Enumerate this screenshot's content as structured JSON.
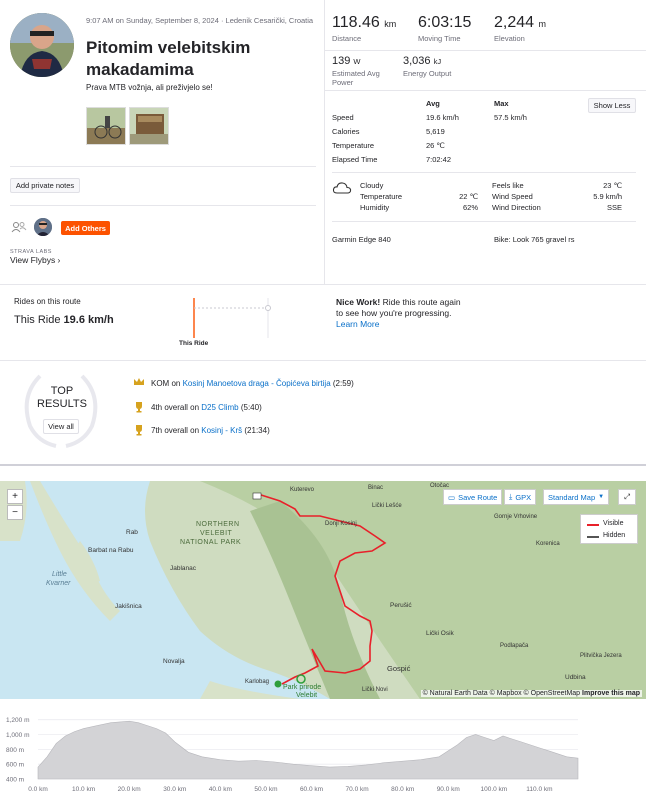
{
  "activity": {
    "datetime": "9:07 AM on Sunday, September 8, 2024",
    "location_sep": " · ",
    "location": "Ledenik Cesarički, Croatia",
    "title_line1": "Pitomim velebitskim",
    "title_line2": "makadamima",
    "description": "Prava MTB vožnja, ali preživjelo se!"
  },
  "buttons": {
    "private_notes": "Add private notes",
    "add_others": "Add Others",
    "show_less": "Show Less",
    "view_all": "View all"
  },
  "labs": {
    "tag": "STRAVA LABS",
    "flybys": "View Flybys ›"
  },
  "stats": {
    "distance": {
      "value": "118.46",
      "unit": "km",
      "label": "Distance"
    },
    "moving_time": {
      "value": "6:03:15",
      "label": "Moving Time"
    },
    "elevation": {
      "value": "2,244",
      "unit": "m",
      "label": "Elevation"
    },
    "power": {
      "value": "139",
      "unit": "W",
      "label1": "Estimated Avg",
      "label2": "Power"
    },
    "energy": {
      "value": "3,036",
      "unit": "kJ",
      "label": "Energy Output"
    }
  },
  "details": {
    "avg_header": "Avg",
    "max_header": "Max",
    "rows": [
      {
        "label": "Speed",
        "avg": "19.6 km/h",
        "max": "57.5 km/h"
      },
      {
        "label": "Calories",
        "avg": "5,619",
        "max": ""
      },
      {
        "label": "Temperature",
        "avg": "26 ℃",
        "max": ""
      },
      {
        "label": "Elapsed Time",
        "avg": "7:02:42",
        "max": ""
      }
    ]
  },
  "weather": {
    "condition": "Cloudy",
    "left": [
      {
        "label": "Temperature",
        "value": "22 ℃"
      },
      {
        "label": "Humidity",
        "value": "62%"
      }
    ],
    "right": [
      {
        "label": "Feels like",
        "value": "23 ℃"
      },
      {
        "label": "Wind Speed",
        "value": "5.9 km/h"
      },
      {
        "label": "Wind Direction",
        "value": "SSE"
      }
    ]
  },
  "device": "Garmin Edge 840",
  "bike": "Bike: Look 765 gravel rs",
  "route": {
    "heading": "Rides on this route",
    "this_ride_prefix": "This Ride",
    "this_ride_speed": "19.6 km/h",
    "chart_label": "This Ride",
    "nice_bold": "Nice Work!",
    "nice_text1": " Ride this route again",
    "nice_text2": "to see how you're progressing.",
    "learn_more": "Learn More"
  },
  "top_results": {
    "line1": "TOP",
    "line2": "RESULTS",
    "items": [
      {
        "rank": "KOM",
        "on": " on ",
        "segment": "Kosinj Manoetova draga - Čopićeva birtija",
        "time": " (2:59)"
      },
      {
        "rank": "4th overall",
        "on": " on ",
        "segment": "D25 Climb",
        "time": " (5:40)"
      },
      {
        "rank": "7th overall",
        "on": " on ",
        "segment": "Kosinj - Krš",
        "time": " (21:34)"
      }
    ]
  },
  "map": {
    "zoom_in": "+",
    "zoom_out": "−",
    "save_route": "Save Route",
    "gpx": "GPX",
    "map_type": "Standard Map",
    "legend_visible": "Visible",
    "legend_hidden": "Hidden",
    "attribution": "© Natural Earth Data © Mapbox © OpenStreetMap",
    "improve": "Improve this map",
    "labels": [
      "NORTHERN",
      "VELEBIT",
      "NATIONAL PARK",
      "Rab",
      "Barbat na Rabu",
      "Little",
      "Kvarner",
      "Jablanac",
      "Jakišnica",
      "Novalja",
      "Karlobag",
      "Park prirode",
      "Velebit",
      "Kuterevo",
      "Donji Kosinj",
      "Perušić",
      "Lički Osik",
      "Gospić",
      "Lički Novi",
      "Otočac",
      "Korenica",
      "Podlapača",
      "Udbina",
      "Lički Lešće",
      "Binac",
      "Gornje Vrhovine",
      "Plitvička Jezera"
    ]
  },
  "elevation_chart": {
    "y_ticks": [
      "1,200 m",
      "1,000 m",
      "800 m",
      "600 m",
      "400 m"
    ],
    "x_ticks": [
      "0.0 km",
      "10.0 km",
      "20.0 km",
      "30.0 km",
      "40.0 km",
      "50.0 km",
      "60.0 km",
      "70.0 km",
      "80.0 km",
      "90.0 km",
      "100.0 km",
      "110.0 km"
    ]
  },
  "chart_data": {
    "type": "area",
    "x_unit": "km",
    "y_unit": "m",
    "ylim": [
      400,
      1250
    ],
    "xlim": [
      0,
      118.46
    ],
    "x": [
      0,
      2,
      4,
      6,
      8,
      10,
      13,
      16,
      18,
      20,
      22,
      24,
      26,
      28,
      30,
      33,
      36,
      40,
      44,
      48,
      52,
      56,
      60,
      64,
      68,
      72,
      76,
      80,
      84,
      88,
      90,
      92,
      94,
      96,
      98,
      100,
      102,
      104,
      106,
      108,
      110,
      112,
      114,
      116,
      118.46
    ],
    "y": [
      560,
      700,
      880,
      980,
      1040,
      1080,
      1120,
      1160,
      1170,
      1180,
      1160,
      1120,
      1080,
      1020,
      900,
      760,
      700,
      660,
      640,
      650,
      630,
      600,
      580,
      560,
      570,
      590,
      620,
      640,
      660,
      700,
      780,
      860,
      960,
      1000,
      960,
      920,
      980,
      940,
      900,
      860,
      820,
      780,
      740,
      700,
      680
    ]
  }
}
